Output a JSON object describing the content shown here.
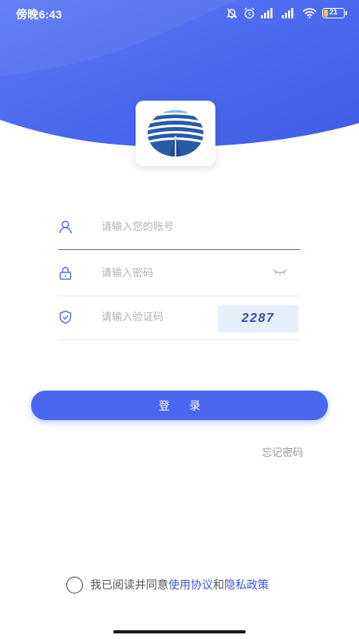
{
  "status_bar": {
    "time": "傍晚6:43",
    "battery": "21"
  },
  "login": {
    "account_placeholder": "请输入您的账号",
    "password_placeholder": "请输入密码",
    "captcha_placeholder": "请输入验证码",
    "captcha_code": "2287",
    "login_button": "登 录",
    "forgot_password": "忘记密码"
  },
  "agreement": {
    "prefix": "我已阅读并同意",
    "terms_link": "使用协议",
    "conjunction": "和",
    "privacy_link": "隐私政策"
  },
  "colors": {
    "primary": "#4a67f0",
    "link": "#3a5ad6",
    "hero": "#4a66ee"
  },
  "icons": [
    "user-icon",
    "lock-icon",
    "shield-check-icon",
    "eye-closed-icon"
  ]
}
